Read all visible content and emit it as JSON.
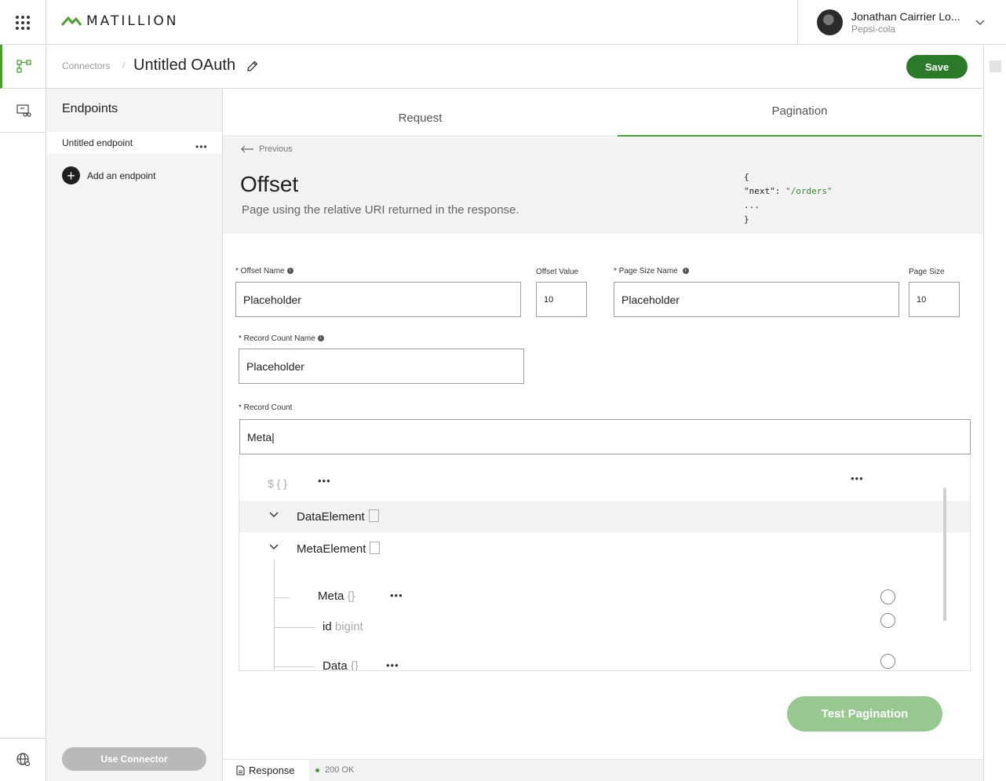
{
  "app": {
    "brand": "MATILLION",
    "brand_color": "#48a02c",
    "save_color": "#2a7a2a"
  },
  "user": {
    "name": "Jonathan Cairrier Lo...",
    "org": "Pepsi-cola"
  },
  "header": {
    "breadcrumb": "Connectors",
    "breadcrumb_sep": "/",
    "title": "Untitled OAuth",
    "save_label": "Save"
  },
  "sidebar": {
    "title": "Endpoints",
    "items": [
      {
        "label": "Untitled endpoint",
        "more": "•••"
      }
    ],
    "add_label": "Add an endpoint",
    "use_connector_label": "Use Connector"
  },
  "tabs": [
    {
      "label": "Request",
      "active": false
    },
    {
      "label": "Pagination",
      "active": true
    }
  ],
  "intro": {
    "previous_label": "Previous",
    "title": "Offset",
    "description": "Page using the relative URI returned in the response.",
    "code_open": "{",
    "code_key": "\"next\": ",
    "code_value": "\"/orders\"",
    "code_ellipsis": "...",
    "code_close": "}"
  },
  "form": {
    "offset_name": {
      "label": "* Offset Name",
      "value": "Placeholder"
    },
    "offset_value": {
      "label": "Offset Value",
      "value": "10"
    },
    "page_size_name": {
      "label": "* Page Size Name",
      "value": "Placeholder"
    },
    "page_size": {
      "label": "Page Size",
      "value": "10"
    },
    "record_count_name": {
      "label": "* Record Count Name",
      "value": "Placeholder"
    },
    "record_count": {
      "label": "* Record Count",
      "value": "Meta|"
    }
  },
  "tree": {
    "root_symbol": "$ { }",
    "more": "•••",
    "nodes": [
      {
        "name": "DataElement"
      },
      {
        "name": "MetaElement"
      }
    ],
    "leaves": [
      {
        "name": "Meta",
        "type": "{}"
      },
      {
        "name": "id",
        "type": "bigint"
      },
      {
        "name": "Data",
        "type": "{}"
      }
    ]
  },
  "actions": {
    "test_label": "Test Pagination"
  },
  "footer": {
    "response_label": "Response",
    "status_text": "200 OK"
  }
}
